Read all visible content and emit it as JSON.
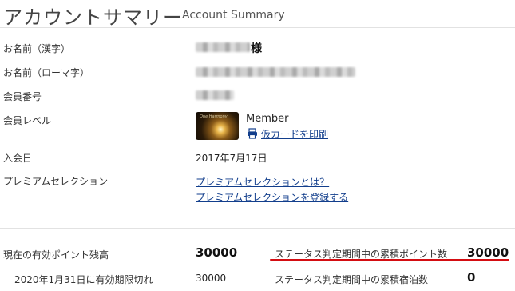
{
  "header": {
    "title_jp": "アカウントサマリー",
    "title_en": "Account Summary"
  },
  "profile": {
    "name_kanji_label": "お名前（漢字）",
    "name_suffix": "様",
    "name_roman_label": "お名前（ローマ字）",
    "member_number_label": "会員番号",
    "member_level_label": "会員レベル",
    "member_level_value": "Member",
    "card_text": "One Harmony",
    "print_card_link": "仮カードを印刷",
    "join_date_label": "入会日",
    "join_date_value": "2017年7月17日",
    "premium_label": "プレミアムセレクション",
    "premium_link_1": "プレミアムセレクションとは？",
    "premium_link_2": "プレミアムセレクションを登録する"
  },
  "points": {
    "balance_label": "現在の有効ポイント残高",
    "balance_value": "30000",
    "expiry_label": "2020年1月31日に有効期限切れ",
    "expiry_value": "30000",
    "status_points_label": "ステータス判定期間中の累積ポイント数",
    "status_points_value": "30000",
    "status_nights_label": "ステータス判定期間中の累積宿泊数",
    "status_nights_value": "0"
  },
  "colors": {
    "link": "#123e8c",
    "highlight_underline": "#d40d12"
  }
}
